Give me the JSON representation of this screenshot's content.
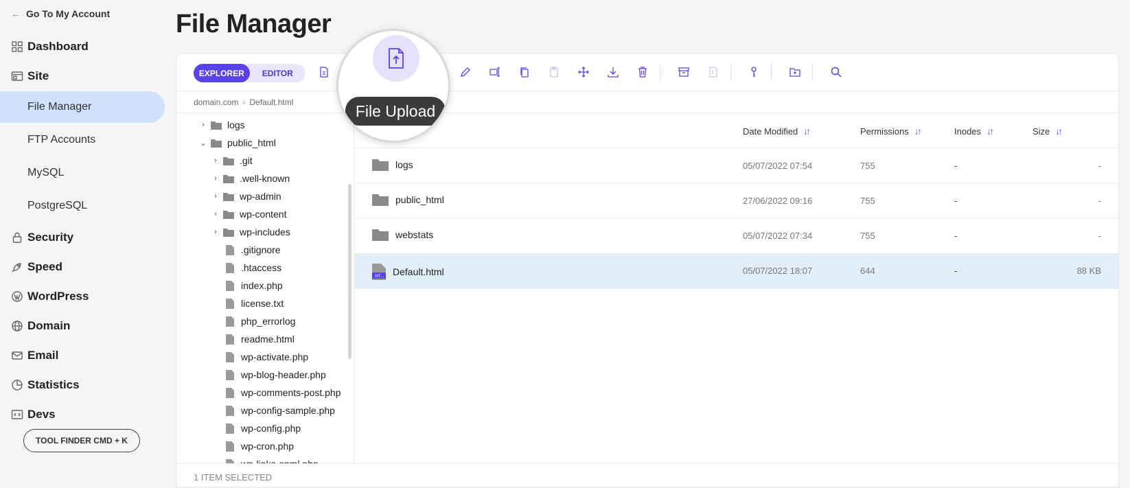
{
  "sidebar": {
    "back_label": "Go To My Account",
    "sections": [
      {
        "label": "Dashboard",
        "icon": "grid-icon"
      },
      {
        "label": "Site",
        "icon": "site-icon"
      }
    ],
    "site_items": [
      "File Manager",
      "FTP Accounts",
      "MySQL",
      "PostgreSQL"
    ],
    "active_item": "File Manager",
    "lower_sections": [
      {
        "label": "Security",
        "icon": "lock-icon"
      },
      {
        "label": "Speed",
        "icon": "rocket-icon"
      },
      {
        "label": "WordPress",
        "icon": "wordpress-icon"
      },
      {
        "label": "Domain",
        "icon": "globe-icon"
      },
      {
        "label": "Email",
        "icon": "mail-icon"
      },
      {
        "label": "Statistics",
        "icon": "pie-chart-icon"
      },
      {
        "label": "Devs",
        "icon": "code-icon"
      }
    ],
    "tool_finder_label": "TOOL FINDER CMD + K"
  },
  "page": {
    "title": "File Manager"
  },
  "toolbar": {
    "explorer_label": "EXPLORER",
    "editor_label": "EDITOR",
    "active_mode": "EXPLORER",
    "tooltip": "File Upload",
    "accent": "#5a43e6"
  },
  "breadcrumb": [
    "domain.com",
    "Default.html"
  ],
  "tree": {
    "items": [
      {
        "label": "logs",
        "type": "folder",
        "depth": 0,
        "expanded": false
      },
      {
        "label": "public_html",
        "type": "folder",
        "depth": 0,
        "expanded": true
      },
      {
        "label": ".git",
        "type": "folder",
        "depth": 1,
        "expanded": false
      },
      {
        "label": ".well-known",
        "type": "folder",
        "depth": 1,
        "expanded": false
      },
      {
        "label": "wp-admin",
        "type": "folder",
        "depth": 1,
        "expanded": false
      },
      {
        "label": "wp-content",
        "type": "folder",
        "depth": 1,
        "expanded": false
      },
      {
        "label": "wp-includes",
        "type": "folder",
        "depth": 1,
        "expanded": false
      },
      {
        "label": ".gitignore",
        "type": "file",
        "depth": 1
      },
      {
        "label": ".htaccess",
        "type": "file",
        "depth": 1
      },
      {
        "label": "index.php",
        "type": "file",
        "depth": 1
      },
      {
        "label": "license.txt",
        "type": "file",
        "depth": 1
      },
      {
        "label": "php_errorlog",
        "type": "file",
        "depth": 1
      },
      {
        "label": "readme.html",
        "type": "file",
        "depth": 1
      },
      {
        "label": "wp-activate.php",
        "type": "file",
        "depth": 1
      },
      {
        "label": "wp-blog-header.php",
        "type": "file",
        "depth": 1
      },
      {
        "label": "wp-comments-post.php",
        "type": "file",
        "depth": 1
      },
      {
        "label": "wp-config-sample.php",
        "type": "file",
        "depth": 1
      },
      {
        "label": "wp-config.php",
        "type": "file",
        "depth": 1
      },
      {
        "label": "wp-cron.php",
        "type": "file",
        "depth": 1
      },
      {
        "label": "wp-links-opml.php",
        "type": "file",
        "depth": 1
      }
    ]
  },
  "list": {
    "columns": {
      "modified": "Date Modified",
      "permissions": "Permissions",
      "inodes": "Inodes",
      "size": "Size"
    },
    "rows": [
      {
        "name": "logs",
        "type": "folder",
        "modified": "05/07/2022 07:54",
        "permissions": "755",
        "inodes": "-",
        "size": "-",
        "selected": false
      },
      {
        "name": "public_html",
        "type": "folder",
        "modified": "27/06/2022 09:16",
        "permissions": "755",
        "inodes": "-",
        "size": "-",
        "selected": false
      },
      {
        "name": "webstats",
        "type": "folder",
        "modified": "05/07/2022 07:34",
        "permissions": "755",
        "inodes": "-",
        "size": "-",
        "selected": false
      },
      {
        "name": "Default.html",
        "type": "html-file",
        "file_badge": ".HT...",
        "modified": "05/07/2022 18:07",
        "permissions": "644",
        "inodes": "-",
        "size": "88 KB",
        "selected": true
      }
    ]
  },
  "status": {
    "text": "1 ITEM SELECTED"
  }
}
